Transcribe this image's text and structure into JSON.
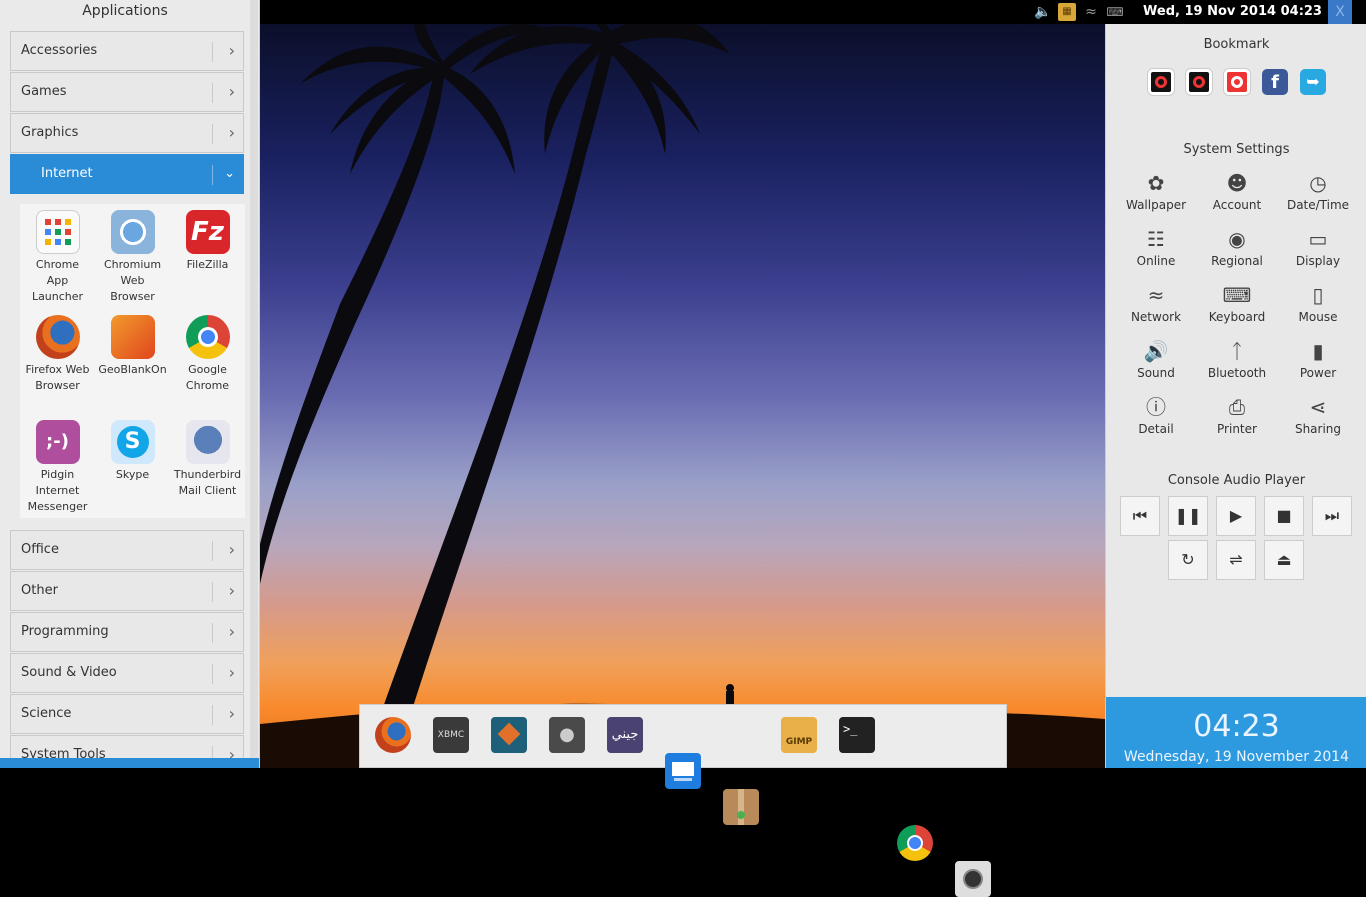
{
  "topbar": {
    "datetime": "Wed, 19 Nov 2014 04:23",
    "close_label": "X",
    "tray_icons": [
      "volume-icon",
      "calendar-icon",
      "wifi-icon",
      "keyboard-icon"
    ]
  },
  "apps_panel": {
    "title": "Applications",
    "categories": [
      "Accessories",
      "Games",
      "Graphics",
      "Internet",
      "Office",
      "Other",
      "Programming",
      "Sound & Video",
      "Science",
      "System Tools"
    ],
    "active_category": "Internet",
    "internet_apps": [
      {
        "name": "Chrome App Launcher",
        "lines": [
          "Chrome",
          "App",
          "Launcher"
        ]
      },
      {
        "name": "Chromium Web Browser",
        "lines": [
          "Chromium",
          "Web",
          "Browser"
        ]
      },
      {
        "name": "FileZilla",
        "lines": [
          "FileZilla"
        ]
      },
      {
        "name": "Firefox Web Browser",
        "lines": [
          "Firefox Web",
          "Browser"
        ]
      },
      {
        "name": "GeoBlankOn",
        "lines": [
          "GeoBlankOn"
        ]
      },
      {
        "name": "Google Chrome",
        "lines": [
          "Google",
          "Chrome"
        ]
      },
      {
        "name": "Pidgin Internet Messenger",
        "lines": [
          "Pidgin",
          "Internet",
          "Messenger"
        ]
      },
      {
        "name": "Skype",
        "lines": [
          "Skype"
        ]
      },
      {
        "name": "Thunderbird Mail Client",
        "lines": [
          "Thunderbird",
          "Mail Client"
        ]
      }
    ]
  },
  "dock": {
    "items": [
      "firefox-icon",
      "xbmc-icon",
      "package-icon",
      "incognito-icon",
      "arabic-app-icon",
      "file-manager-icon",
      "archive-icon",
      "gimp-icon",
      "terminal-icon",
      "chrome-icon",
      "camera-icon"
    ],
    "xbmc_label": "XBMC",
    "gimp_label": "GIMP",
    "arabic_label": "جيني",
    "terminal_label": ">_"
  },
  "right_panel": {
    "bookmark_title": "Bookmark",
    "bookmarks": [
      "bookmark-1-icon",
      "bookmark-2-icon",
      "bookmark-3-icon",
      "facebook-icon",
      "twitter-icon"
    ],
    "settings_title": "System Settings",
    "settings": [
      {
        "label": "Wallpaper",
        "icon": "wallpaper-icon"
      },
      {
        "label": "Account",
        "icon": "account-icon"
      },
      {
        "label": "Date/Time",
        "icon": "clock-icon"
      },
      {
        "label": "Online",
        "icon": "globe-icon"
      },
      {
        "label": "Regional",
        "icon": "earth-icon"
      },
      {
        "label": "Display",
        "icon": "monitor-icon"
      },
      {
        "label": "Network",
        "icon": "wifi-icon"
      },
      {
        "label": "Keyboard",
        "icon": "keyboard-icon"
      },
      {
        "label": "Mouse",
        "icon": "mouse-icon"
      },
      {
        "label": "Sound",
        "icon": "speaker-icon"
      },
      {
        "label": "Bluetooth",
        "icon": "bluetooth-icon"
      },
      {
        "label": "Power",
        "icon": "battery-icon"
      },
      {
        "label": "Detail",
        "icon": "info-icon"
      },
      {
        "label": "Printer",
        "icon": "printer-icon"
      },
      {
        "label": "Sharing",
        "icon": "share-icon"
      }
    ],
    "audio_title": "Console Audio Player",
    "audio_controls": [
      "previous-icon",
      "pause-icon",
      "play-icon",
      "stop-icon",
      "next-icon",
      "repeat-icon",
      "shuffle-icon",
      "eject-icon"
    ],
    "clock_time": "04:23",
    "clock_date": "Wednesday, 19 November 2014"
  },
  "colors": {
    "accent": "#2a8bd6",
    "panel_bg": "#e8e8e8",
    "clock_bg": "#2d9ae0"
  }
}
